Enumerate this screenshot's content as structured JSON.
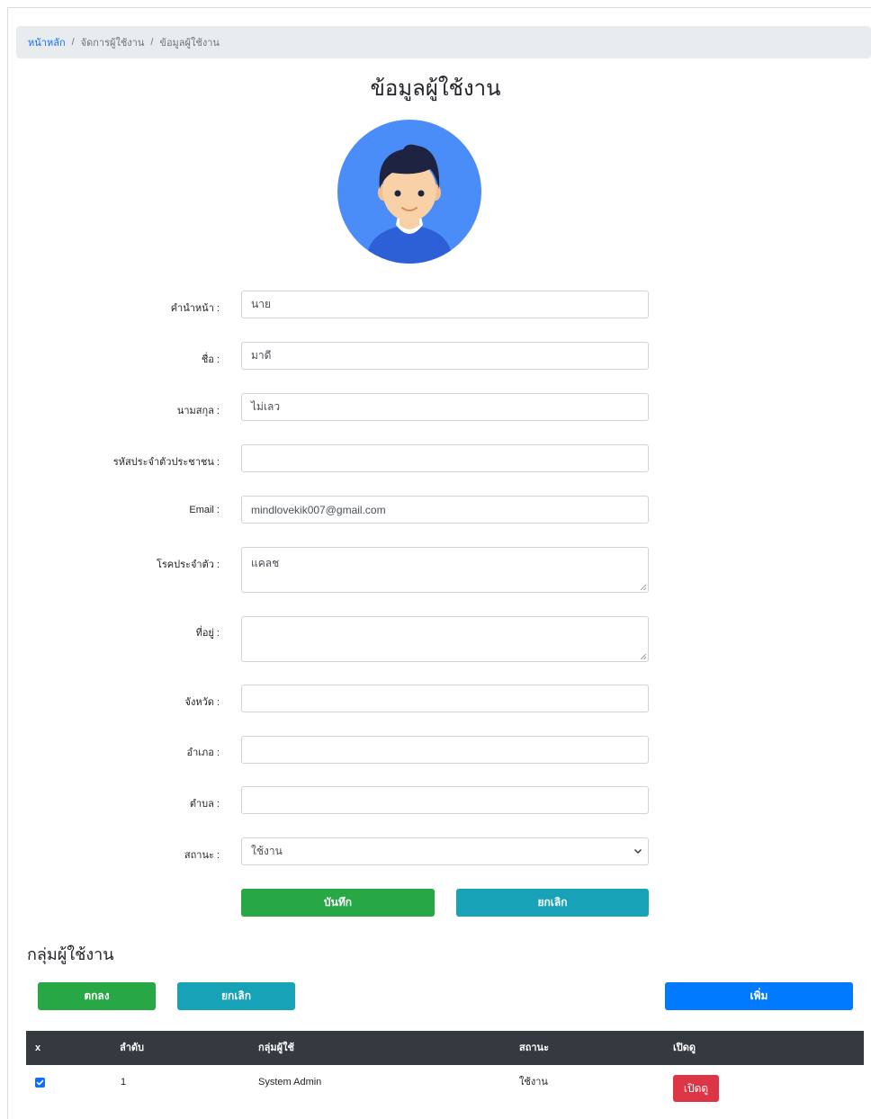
{
  "breadcrumb": {
    "home": "หน้าหลัก",
    "middle": "จัดการผู้ใช้งาน",
    "current": "ข้อมูลผู้ใช้งาน"
  },
  "page_title": "ข้อมูลผู้ใช้งาน",
  "form": {
    "prefix": {
      "label": "คำนำหน้า :",
      "value": "นาย"
    },
    "first_name": {
      "label": "ชื่อ :",
      "value": "มาดี"
    },
    "last_name": {
      "label": "นามสกุล :",
      "value": "ไม่เลว"
    },
    "citizen_id": {
      "label": "รหัสประจำตัวประชาชน :",
      "value": ""
    },
    "email": {
      "label": "Email :",
      "value": "mindlovekik007@gmail.com"
    },
    "disease": {
      "label": "โรคประจำตัว :",
      "value": "แคลช"
    },
    "address": {
      "label": "ที่อยู่ :",
      "value": ""
    },
    "province": {
      "label": "จังหวัด :",
      "value": ""
    },
    "district": {
      "label": "อำเภอ :",
      "value": ""
    },
    "subdistrict": {
      "label": "ตำบล :",
      "value": ""
    },
    "status": {
      "label": "สถานะ :",
      "value": "ใช้งาน"
    },
    "save_label": "บันทึก",
    "cancel_label": "ยกเลิก"
  },
  "groups": {
    "title": "กลุ่มผู้ใช้งาน",
    "ok_label": "ตกลง",
    "cancel_label": "ยกเลิก",
    "add_label": "เพิ่ม",
    "columns": [
      "x",
      "ลำดับ",
      "กลุ่มผู้ใช้",
      "สถานะ",
      "เปิดดู"
    ],
    "rows": [
      {
        "checked": true,
        "order": "1",
        "group": "System Admin",
        "status": "ใช้งาน",
        "view_label": "เปิดดู"
      }
    ]
  },
  "colors": {
    "success": "#28a745",
    "info": "#17a2b8",
    "primary": "#007bff",
    "danger": "#dc3545",
    "table_header": "#343a40",
    "avatar_bg": "#4a8df8"
  },
  "icons": [
    "user-avatar-icon",
    "chevron-down-icon",
    "checkbox-checked-icon",
    "resize-grip-icon"
  ]
}
